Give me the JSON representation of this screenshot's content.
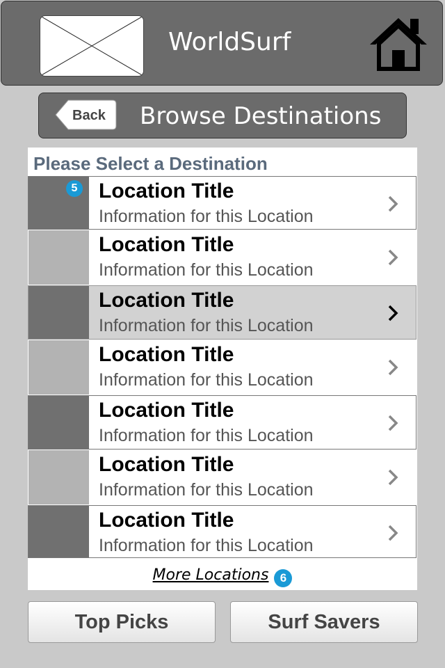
{
  "header": {
    "app_title": "WorldSurf",
    "logo": "image-placeholder",
    "home_icon": "home-icon"
  },
  "subheader": {
    "back_label": "Back",
    "title": "Browse Destinations"
  },
  "list": {
    "prompt": "Please Select a Destination",
    "items": [
      {
        "title": "Location Title",
        "info": "Information for this Location",
        "badge": "5"
      },
      {
        "title": "Location Title",
        "info": "Information for this Location"
      },
      {
        "title": "Location Title",
        "info": "Information for this Location",
        "selected": true
      },
      {
        "title": "Location Title",
        "info": "Information for this Location"
      },
      {
        "title": "Location Title",
        "info": "Information for this Location"
      },
      {
        "title": "Location Title",
        "info": "Information for this Location"
      },
      {
        "title": "Location Title",
        "info": "Information for this Location"
      }
    ],
    "more_label": "More Locations",
    "more_badge": "6"
  },
  "bottom": {
    "left_label": "Top Picks",
    "right_label": "Surf Savers"
  },
  "colors": {
    "header_bg": "#6b6b6b",
    "badge": "#1a9ad6",
    "prompt_text": "#5a6a7c"
  }
}
